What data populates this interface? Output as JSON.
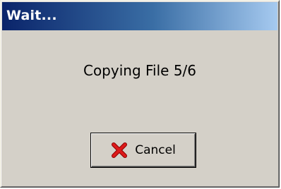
{
  "window": {
    "title": "Wait...",
    "message": "Copying File 5/6"
  },
  "buttons": {
    "cancel_label": "Cancel",
    "cancel_icon": "red-x-icon"
  },
  "colors": {
    "title_bar_start": "#0a246a",
    "title_bar_end": "#a6caf0",
    "face": "#d4d0c8",
    "cancel_icon": "#cc0000"
  }
}
